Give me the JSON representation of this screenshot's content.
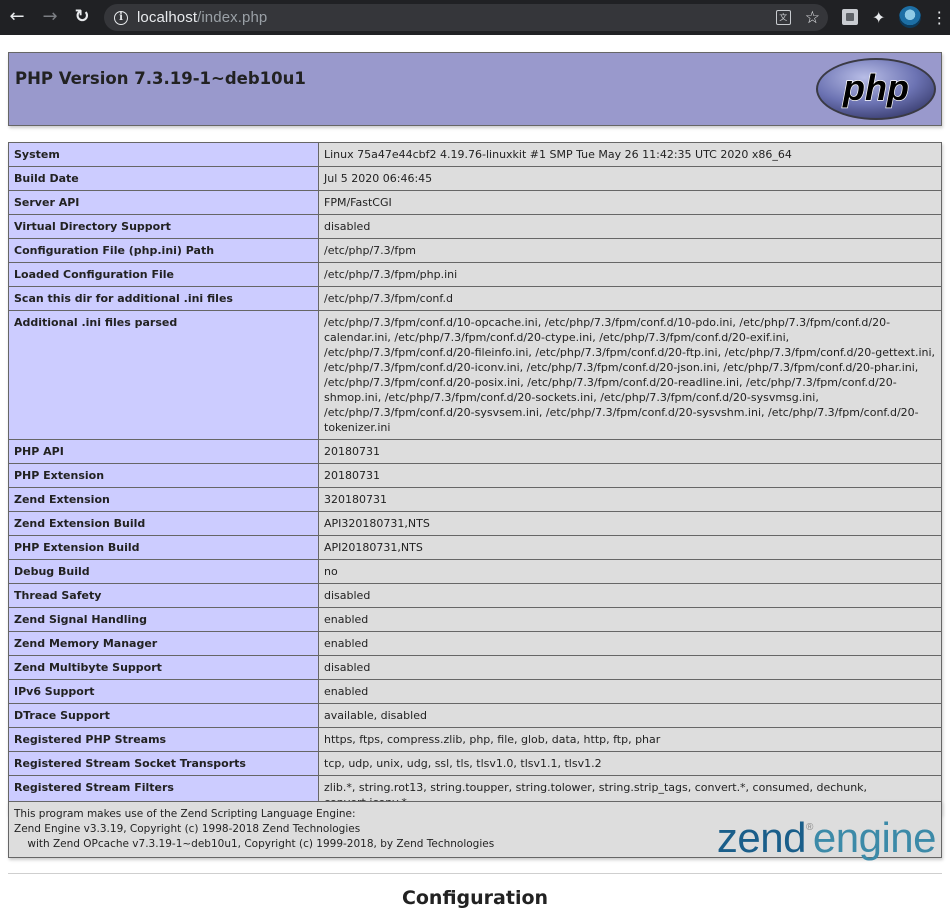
{
  "browser": {
    "url_host": "localhost",
    "url_path": "/index.php",
    "info_glyph": "i",
    "icons": {
      "back": "←",
      "forward": "→",
      "reload": "↻",
      "translate": "文",
      "star": "☆",
      "puzzle": "✦",
      "menu": "⋮"
    }
  },
  "header": {
    "title": "PHP Version 7.3.19-1~deb10u1",
    "logo_text": "php"
  },
  "rows": [
    {
      "key": "System",
      "value": "Linux 75a47e44cbf2 4.19.76-linuxkit #1 SMP Tue May 26 11:42:35 UTC 2020 x86_64"
    },
    {
      "key": "Build Date",
      "value": "Jul 5 2020 06:46:45"
    },
    {
      "key": "Server API",
      "value": "FPM/FastCGI"
    },
    {
      "key": "Virtual Directory Support",
      "value": "disabled"
    },
    {
      "key": "Configuration File (php.ini) Path",
      "value": "/etc/php/7.3/fpm"
    },
    {
      "key": "Loaded Configuration File",
      "value": "/etc/php/7.3/fpm/php.ini"
    },
    {
      "key": "Scan this dir for additional .ini files",
      "value": "/etc/php/7.3/fpm/conf.d"
    },
    {
      "key": "Additional .ini files parsed",
      "value": "/etc/php/7.3/fpm/conf.d/10-opcache.ini, /etc/php/7.3/fpm/conf.d/10-pdo.ini, /etc/php/7.3/fpm/conf.d/20-calendar.ini, /etc/php/7.3/fpm/conf.d/20-ctype.ini, /etc/php/7.3/fpm/conf.d/20-exif.ini, /etc/php/7.3/fpm/conf.d/20-fileinfo.ini, /etc/php/7.3/fpm/conf.d/20-ftp.ini, /etc/php/7.3/fpm/conf.d/20-gettext.ini, /etc/php/7.3/fpm/conf.d/20-iconv.ini, /etc/php/7.3/fpm/conf.d/20-json.ini, /etc/php/7.3/fpm/conf.d/20-phar.ini, /etc/php/7.3/fpm/conf.d/20-posix.ini, /etc/php/7.3/fpm/conf.d/20-readline.ini, /etc/php/7.3/fpm/conf.d/20-shmop.ini, /etc/php/7.3/fpm/conf.d/20-sockets.ini, /etc/php/7.3/fpm/conf.d/20-sysvmsg.ini, /etc/php/7.3/fpm/conf.d/20-sysvsem.ini, /etc/php/7.3/fpm/conf.d/20-sysvshm.ini, /etc/php/7.3/fpm/conf.d/20-tokenizer.ini"
    },
    {
      "key": "PHP API",
      "value": "20180731"
    },
    {
      "key": "PHP Extension",
      "value": "20180731"
    },
    {
      "key": "Zend Extension",
      "value": "320180731"
    },
    {
      "key": "Zend Extension Build",
      "value": "API320180731,NTS"
    },
    {
      "key": "PHP Extension Build",
      "value": "API20180731,NTS"
    },
    {
      "key": "Debug Build",
      "value": "no"
    },
    {
      "key": "Thread Safety",
      "value": "disabled"
    },
    {
      "key": "Zend Signal Handling",
      "value": "enabled"
    },
    {
      "key": "Zend Memory Manager",
      "value": "enabled"
    },
    {
      "key": "Zend Multibyte Support",
      "value": "disabled"
    },
    {
      "key": "IPv6 Support",
      "value": "enabled"
    },
    {
      "key": "DTrace Support",
      "value": "available, disabled"
    },
    {
      "key": "Registered PHP Streams",
      "value": "https, ftps, compress.zlib, php, file, glob, data, http, ftp, phar"
    },
    {
      "key": "Registered Stream Socket Transports",
      "value": "tcp, udp, unix, udg, ssl, tls, tlsv1.0, tlsv1.1, tlsv1.2"
    },
    {
      "key": "Registered Stream Filters",
      "value": "zlib.*, string.rot13, string.toupper, string.tolower, string.strip_tags, convert.*, consumed, dechunk, convert.iconv.*"
    }
  ],
  "zend": {
    "line1": "This program makes use of the Zend Scripting Language Engine:",
    "line2": "Zend Engine v3.3.19, Copyright (c) 1998-2018 Zend Technologies",
    "line3": "    with Zend OPcache v7.3.19-1~deb10u1, Copyright (c) 1999-2018, by Zend Technologies",
    "logo_part1": "zend",
    "logo_reg": "®",
    "logo_part2": "engine"
  },
  "configuration_heading": "Configuration"
}
